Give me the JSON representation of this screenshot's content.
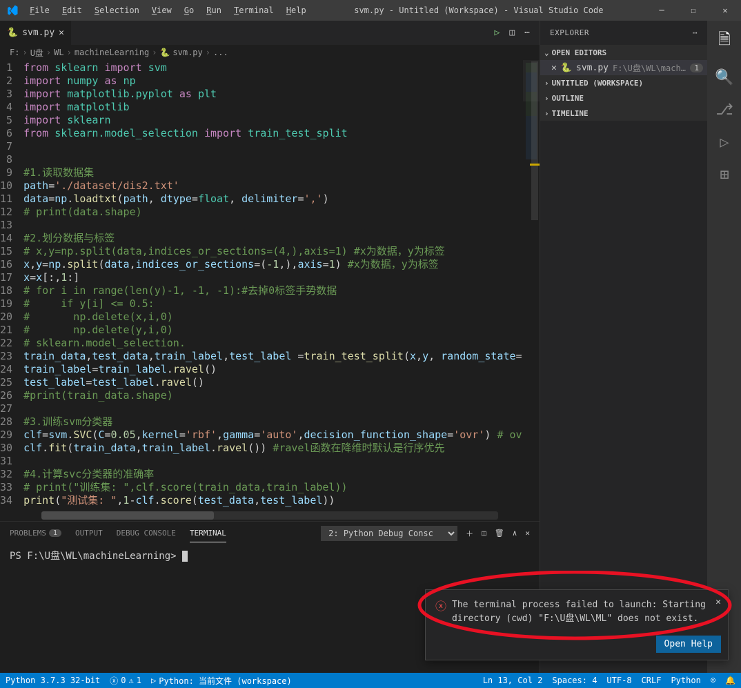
{
  "title": "svm.py - Untitled (Workspace) - Visual Studio Code",
  "menu": [
    "File",
    "Edit",
    "Selection",
    "View",
    "Go",
    "Run",
    "Terminal",
    "Help"
  ],
  "tab": {
    "name": "svm.py"
  },
  "breadcrumbs": {
    "p1": "F:",
    "p2": "U盘",
    "p3": "WL",
    "p4": "machineLearning",
    "p5": "svm.py",
    "p6": "..."
  },
  "explorer": {
    "title": "EXPLORER",
    "open_editors": "OPEN EDITORS",
    "file": "svm.py",
    "filepath": "F:\\U盘\\WL\\machine...",
    "badge": "1",
    "untitled": "UNTITLED (WORKSPACE)",
    "outline": "OUTLINE",
    "timeline": "TIMELINE"
  },
  "code": [
    {
      "n": 1,
      "html": "<span class='kw'>from</span> <span class='mod'>sklearn</span> <span class='kw'>import</span> <span class='mod'>svm</span>"
    },
    {
      "n": 2,
      "html": "<span class='kw'>import</span> <span class='mod'>numpy</span> <span class='kw'>as</span> <span class='mod'>np</span>"
    },
    {
      "n": 3,
      "html": "<span class='kw'>import</span> <span class='mod'>matplotlib.pyplot</span> <span class='kw'>as</span> <span class='mod'>plt</span>"
    },
    {
      "n": 4,
      "html": "<span class='kw'>import</span> <span class='mod'>matplotlib</span>"
    },
    {
      "n": 5,
      "html": "<span class='kw'>import</span> <span class='mod'>sklearn</span>"
    },
    {
      "n": 6,
      "html": "<span class='kw'>from</span> <span class='mod'>sklearn.model_selection</span> <span class='kw'>import</span> <span class='mod'>train_test_split</span>"
    },
    {
      "n": 7,
      "html": ""
    },
    {
      "n": 8,
      "html": ""
    },
    {
      "n": 9,
      "html": "<span class='cmt'>#1.读取数据集</span>"
    },
    {
      "n": 10,
      "html": "<span class='var'>path</span>=<span class='str'>'./dataset/dis2.txt'</span>"
    },
    {
      "n": 11,
      "html": "<span class='var'>data</span>=<span class='var'>np</span>.<span class='fn'>loadtxt</span>(<span class='var'>path</span>, <span class='var'>dtype</span>=<span class='mod'>float</span>, <span class='var'>delimiter</span>=<span class='str'>','</span>)"
    },
    {
      "n": 12,
      "html": "<span class='cmt'># print(data.shape)</span>"
    },
    {
      "n": 13,
      "html": ""
    },
    {
      "n": 14,
      "html": "<span class='cmt'>#2.划分数据与标签</span>"
    },
    {
      "n": 15,
      "html": "<span class='cmt'># x,y=np.split(data,indices_or_sections=(4,),axis=1) #x为数据，y为标签</span>"
    },
    {
      "n": 16,
      "html": "<span class='var'>x</span>,<span class='var'>y</span>=<span class='var'>np</span>.<span class='fn'>split</span>(<span class='var'>data</span>,<span class='var'>indices_or_sections</span>=(<span class='num'>-1</span>,),<span class='var'>axis</span>=<span class='num'>1</span>) <span class='cmt'>#x为数据，y为标签</span>"
    },
    {
      "n": 17,
      "html": "<span class='var'>x</span>=<span class='var'>x</span>[:,<span class='num'>1</span>:]"
    },
    {
      "n": 18,
      "html": "<span class='cmt'># for i in range(len(y)-1, -1, -1):#去掉0标签手势数据</span>"
    },
    {
      "n": 19,
      "html": "<span class='cmt'>#     if y[i] <= 0.5:</span>"
    },
    {
      "n": 20,
      "html": "<span class='cmt'>#       np.delete(x,i,0)</span>"
    },
    {
      "n": 21,
      "html": "<span class='cmt'>#       np.delete(y,i,0)</span>"
    },
    {
      "n": 22,
      "html": "<span class='cmt'># sklearn.model_selection.</span>"
    },
    {
      "n": 23,
      "html": "<span class='var'>train_data</span>,<span class='var'>test_data</span>,<span class='var'>train_label</span>,<span class='var'>test_label</span> =<span class='fn'>train_test_split</span>(<span class='var'>x</span>,<span class='var'>y</span>, <span class='var'>random_state</span>="
    },
    {
      "n": 24,
      "html": "<span class='var'>train_label</span>=<span class='var'>train_label</span>.<span class='fn'>ravel</span>()"
    },
    {
      "n": 25,
      "html": "<span class='var'>test_label</span>=<span class='var'>test_label</span>.<span class='fn'>ravel</span>()"
    },
    {
      "n": 26,
      "html": "<span class='cmt'>#print(train_data.shape)</span>"
    },
    {
      "n": 27,
      "html": ""
    },
    {
      "n": 28,
      "html": "<span class='cmt'>#3.训练svm分类器</span>"
    },
    {
      "n": 29,
      "html": "<span class='var'>clf</span>=<span class='var'>svm</span>.<span class='fn'>SVC</span>(<span class='var'>C</span>=<span class='num'>0.05</span>,<span class='var'>kernel</span>=<span class='str'>'rbf'</span>,<span class='var'>gamma</span>=<span class='str'>'auto'</span>,<span class='var'>decision_function_shape</span>=<span class='str'>'ovr'</span>) <span class='cmt'># ov</span>"
    },
    {
      "n": 30,
      "html": "<span class='var'>clf</span>.<span class='fn'>fit</span>(<span class='var'>train_data</span>,<span class='var'>train_label</span>.<span class='fn'>ravel</span>()) <span class='cmt'>#ravel函数在降维时默认是行序优先</span>"
    },
    {
      "n": 31,
      "html": ""
    },
    {
      "n": 32,
      "html": "<span class='cmt'>#4.计算svc分类器的准确率</span>"
    },
    {
      "n": 33,
      "html": "<span class='cmt'># print(\"训练集: \",clf.score(train_data,train_label))</span>"
    },
    {
      "n": 34,
      "html": "<span class='fn'>print</span>(<span class='str'>\"测试集: \"</span>,<span class='num'>1</span>-<span class='var'>clf</span>.<span class='fn'>score</span>(<span class='var'>test_data</span>,<span class='var'>test_label</span>))"
    }
  ],
  "panel": {
    "problems": "PROBLEMS",
    "problems_count": "1",
    "output": "OUTPUT",
    "debug": "DEBUG CONSOLE",
    "terminal": "TERMINAL",
    "selector": "2: Python Debug Consc",
    "prompt": "PS F:\\U盘\\WL\\machineLearning> "
  },
  "notification": {
    "text": "The terminal process failed to launch: Starting directory (cwd) \"F:\\U盘\\WL\\ML\" does not exist.",
    "button": "Open Help"
  },
  "status": {
    "python": "Python 3.7.3 32-bit",
    "errors": "0",
    "warnings": "1",
    "runconf": "Python: 当前文件 (workspace)",
    "lncol": "Ln 13, Col 2",
    "spaces": "Spaces: 4",
    "enc": "UTF-8",
    "eol": "CRLF",
    "lang": "Python",
    "bell": "🔔"
  }
}
